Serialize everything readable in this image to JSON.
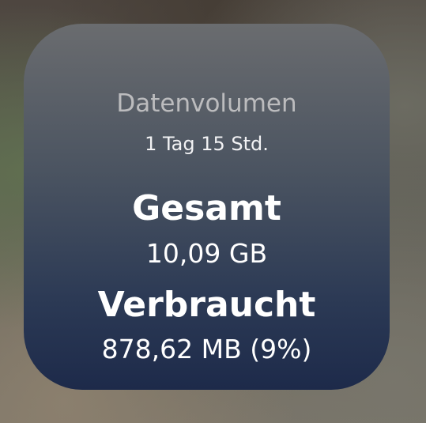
{
  "widget": {
    "title": "Datenvolumen",
    "period": "1 Tag 15 Std.",
    "total_label": "Gesamt",
    "total_value": "10,09 GB",
    "used_label": "Verbraucht",
    "used_value": "878,62 MB (9%)"
  }
}
